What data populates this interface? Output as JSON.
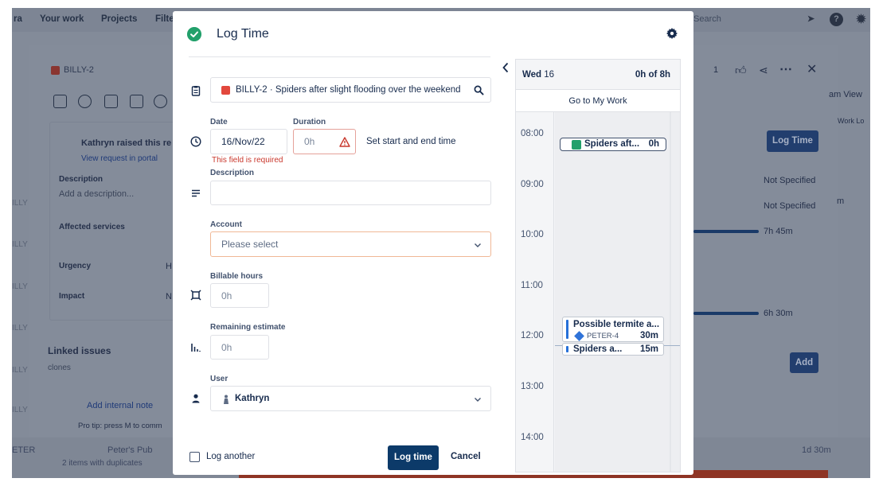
{
  "background": {
    "nav": [
      "Your work",
      "Projects",
      "Filte"
    ],
    "search_placeholder": "Search",
    "issue_key": "BILLY-2",
    "reporter_text": "Kathryn raised this re",
    "view_request_link": "View request in portal",
    "description_label": "Description",
    "description_placeholder": "Add a description...",
    "affected_services_label": "Affected services",
    "urgency_label": "Urgency",
    "urgency_value": "H",
    "impact_label": "Impact",
    "impact_value": "N",
    "linked_issues_label": "Linked issues",
    "clones_label": "clones",
    "add_internal_note": "Add internal note",
    "pro_tip": "Pro tip: press M to comm",
    "watch_count": "1",
    "log_time_button": "Log Time",
    "not_specified_1": "Not Specified",
    "not_specified_2": "Not Specified",
    "time_1": "7h 45m",
    "time_2": "6h 30m",
    "add_button": "Add",
    "team_view": "am View",
    "work_log": "Work Lo",
    "side_suffix_m": "m",
    "footer_project": "Peter's Pub",
    "footer_items": "2 items with duplicates",
    "footer_time": "1d 30m",
    "footer_peter": "ETER",
    "side_labels": [
      "ILLY",
      "ILLY",
      "ILLY",
      "ILLY",
      "ILLY",
      "ILLY"
    ]
  },
  "modal": {
    "title": "Log Time",
    "issue_key_summary": "BILLY-2 · Spiders after slight flooding over the weekend",
    "date_label": "Date",
    "date_value": "16/Nov/22",
    "duration_label": "Duration",
    "duration_placeholder": "0h",
    "set_start_end": "Set start and end time",
    "error_text": "This field is required",
    "description_label": "Description",
    "description_value": "",
    "account_label": "Account",
    "account_placeholder": "Please select",
    "billable_label": "Billable hours",
    "billable_placeholder": "0h",
    "remaining_label": "Remaining estimate",
    "remaining_placeholder": "0h",
    "user_label": "User",
    "user_value": "Kathryn",
    "log_another_label": "Log another",
    "log_another_checked": false,
    "log_time_button": "Log time",
    "cancel_button": "Cancel"
  },
  "calendar": {
    "day": "Wed",
    "date": "16",
    "total": "0h of 8h",
    "goto_label": "Go to My Work",
    "hours": [
      "08:00",
      "09:00",
      "10:00",
      "11:00",
      "12:00",
      "13:00",
      "14:00"
    ],
    "worklogs": [
      {
        "title": "Spiders aft...",
        "duration": "0h"
      },
      {
        "title": "Possible termite a...",
        "key": "PETER-4",
        "duration": "30m"
      },
      {
        "title": "Spiders a...",
        "duration": "15m"
      }
    ]
  },
  "colors": {
    "primary_button": "#0c3a69",
    "success": "#22a06b",
    "error": "#c9372c",
    "issue_badge": "#e2483d",
    "story_icon": "#2f73d8"
  }
}
